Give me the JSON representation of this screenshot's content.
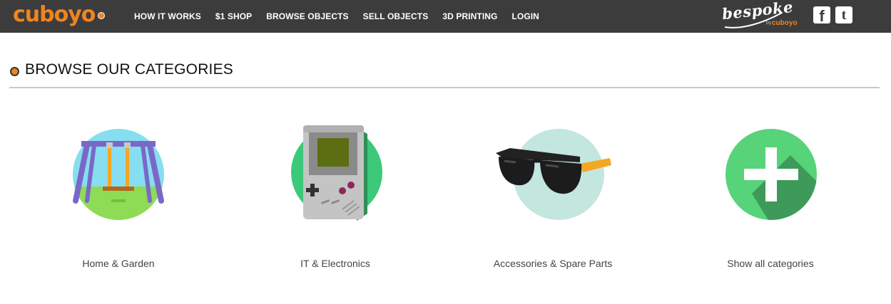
{
  "header": {
    "logo_text": "cuboyo",
    "nav": [
      "HOW IT WORKS",
      "$1 SHOP",
      "BROWSE OBJECTS",
      "SELL OBJECTS",
      "3D PRINTING",
      "LOGIN"
    ],
    "bespoke": {
      "word": "bespoke",
      "by": "by",
      "brand": "cuboyo"
    },
    "social": {
      "facebook": "f",
      "twitter": "t"
    }
  },
  "section": {
    "title": "BROWSE OUR CATEGORIES"
  },
  "categories": [
    {
      "label": "Home & Garden",
      "icon": "swing-icon"
    },
    {
      "label": "IT & Electronics",
      "icon": "gameboy-icon"
    },
    {
      "label": "Accessories & Spare Parts",
      "icon": "sunglasses-icon"
    },
    {
      "label": "Show all categories",
      "icon": "plus-icon"
    }
  ],
  "colors": {
    "brand": "#f0841e",
    "topbar": "#3c3c3c",
    "green": "#57d37a"
  }
}
